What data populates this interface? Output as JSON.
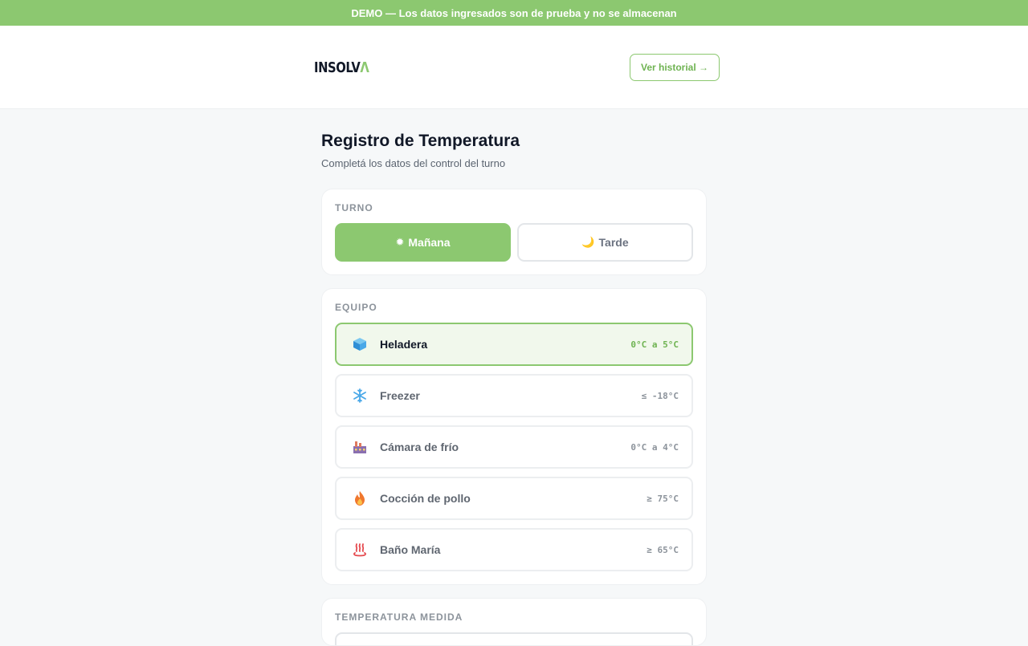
{
  "banner": {
    "text": "DEMO — Los datos ingresados son de prueba y no se almacenan"
  },
  "header": {
    "logo_main": "INSOLV",
    "logo_accent": "Λ",
    "history_button": "Ver historial →"
  },
  "page": {
    "title": "Registro de Temperatura",
    "subtitle": "Completá los datos del control del turno"
  },
  "shift": {
    "label": "TURNO",
    "options": [
      {
        "label": "Mañana",
        "icon": "sun-icon",
        "glyph": "✹",
        "selected": true
      },
      {
        "label": "Tarde",
        "icon": "moon-icon",
        "glyph": "🌙",
        "selected": false
      }
    ]
  },
  "equipment": {
    "label": "EQUIPO",
    "items": [
      {
        "name": "Heladera",
        "range": "0°C a 5°C",
        "icon": "ice-cube-icon",
        "selected": true
      },
      {
        "name": "Freezer",
        "range": "≤ -18°C",
        "icon": "snowflake-icon",
        "selected": false
      },
      {
        "name": "Cámara de frío",
        "range": "0°C a 4°C",
        "icon": "factory-icon",
        "selected": false
      },
      {
        "name": "Cocción de pollo",
        "range": "≥ 75°C",
        "icon": "fire-icon",
        "selected": false
      },
      {
        "name": "Baño María",
        "range": "≥ 65°C",
        "icon": "hot-springs-icon",
        "selected": false
      }
    ]
  },
  "temperature": {
    "label": "TEMPERATURA MEDIDA"
  },
  "colors": {
    "accent": "#8cc870",
    "accent_dark": "#6fb352",
    "selected_bg": "#f1f8ec"
  }
}
